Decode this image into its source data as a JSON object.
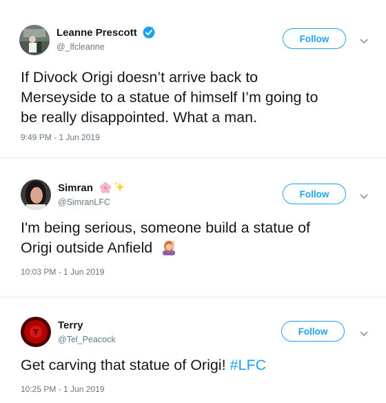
{
  "tweets": [
    {
      "name": "Leanne Prescott",
      "handle": "@_lfcleanne",
      "follow_label": "Follow",
      "text_lines": [
        "If Divock Origi doesn’t arrive back to",
        "Merseyside to a statue of himself I’m going to",
        "be really disappointed. What a man."
      ],
      "timestamp": "9:49 PM - 1 Jun 2019",
      "verified": true
    },
    {
      "name": "Simran",
      "handle": "@SimranLFC",
      "follow_label": "Follow",
      "name_emoji": [
        "cherry-blossom",
        "sparkles"
      ],
      "text_lines": [
        "I'm being serious, someone build a statue of",
        "Origi outside Anfield"
      ],
      "text_emoji": "person-raising-hand",
      "timestamp": "10:03 PM - 1 Jun 2019"
    },
    {
      "name": "Terry",
      "handle": "@Tel_Peacock",
      "follow_label": "Follow",
      "text_before_hashtag": "Get carving that statue of Origi!",
      "hashtag": "#LFC",
      "timestamp": "10:25 PM - 1 Jun 2019"
    }
  ],
  "colors": {
    "accent": "#1da1f2",
    "text": "#14171a",
    "muted": "#657786"
  }
}
